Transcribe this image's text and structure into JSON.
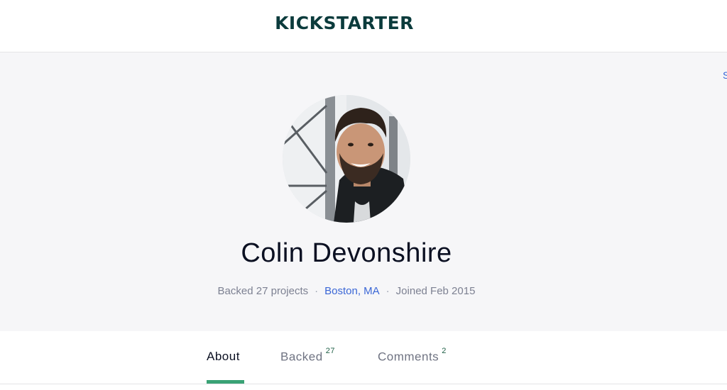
{
  "header": {
    "logo_text": "KICKSTARTER",
    "brand_color": "#0b3b3c"
  },
  "hero": {
    "edge_link": "S",
    "profile_name": "Colin Devonshire",
    "backed_text": "Backed 27 projects",
    "separator": "·",
    "location": "Boston, MA",
    "joined_text": "Joined Feb 2015"
  },
  "tabs": [
    {
      "label": "About",
      "count": "",
      "active": true
    },
    {
      "label": "Backed",
      "count": "27",
      "active": false
    },
    {
      "label": "Comments",
      "count": "2",
      "active": false
    }
  ],
  "colors": {
    "accent_green": "#3aa275",
    "link_blue": "#3b67d6",
    "hero_bg": "#f6f6f8"
  },
  "icons": {
    "avatar": "profile-photo"
  }
}
